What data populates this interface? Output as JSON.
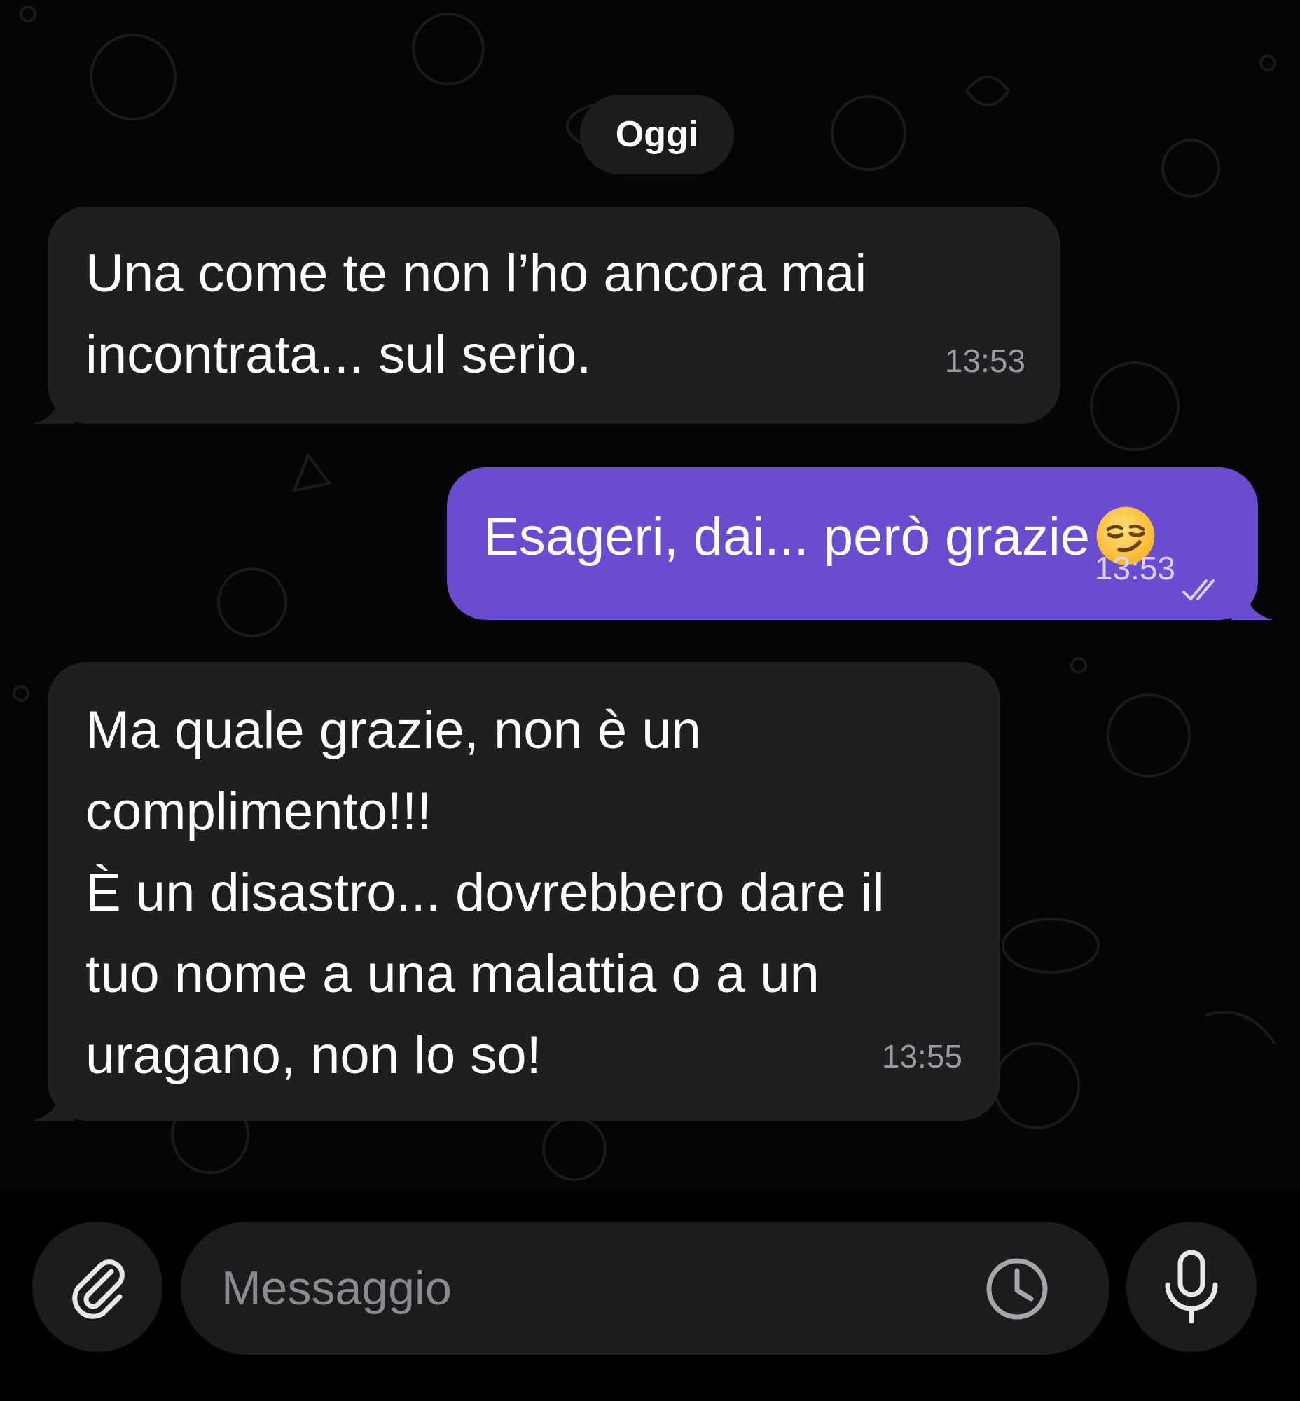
{
  "chat": {
    "date_separator": "Oggi",
    "messages": [
      {
        "direction": "incoming",
        "lines": [
          "Una come te non l’ho ancora mai",
          "incontrata... sul serio."
        ],
        "time": "13:53"
      },
      {
        "direction": "outgoing",
        "text": "Esageri, dai... però grazie",
        "emoji": "smirking-face-emoji",
        "time": "13:53",
        "status": "read-double-check"
      },
      {
        "direction": "incoming",
        "lines": [
          "Ma quale grazie, non è un",
          "complimento!!!",
          "È un disastro... dovrebbero dare il",
          "tuo nome a una malattia o a un",
          "uragano, non lo so!"
        ],
        "time": "13:55"
      }
    ]
  },
  "composer": {
    "placeholder": "Messaggio",
    "value": "",
    "attach_icon": "paperclip-icon",
    "sticker_icon": "sticker-clock-icon",
    "voice_icon": "microphone-icon"
  },
  "colors": {
    "background": "#000000",
    "incoming_bubble": "#1f1f22",
    "outgoing_bubble": "#6a4ccf",
    "timestamp": "#9a9aa0"
  }
}
